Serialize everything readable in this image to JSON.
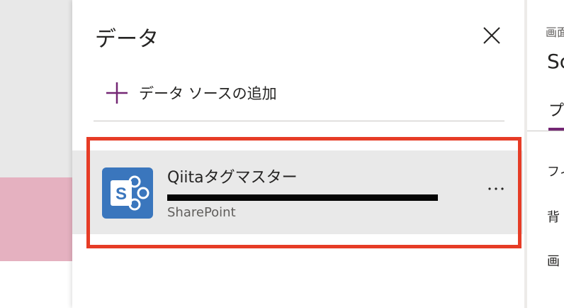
{
  "panel": {
    "title": "データ",
    "add_label": "データ ソースの追加",
    "close_icon": "close-icon",
    "plus_icon": "plus-icon",
    "accent_color": "#742774"
  },
  "data_sources": [
    {
      "name": "Qiitaタグマスター",
      "url": "",
      "type": "SharePoint",
      "icon": "sharepoint-icon",
      "icon_color": "#3a76bd"
    }
  ],
  "highlight_color": "#e63c26",
  "right_panel": {
    "screen_label": "画面",
    "screen_name": "Sc",
    "tab_label": "プ",
    "props": [
      "フィ",
      "背",
      "画"
    ]
  }
}
